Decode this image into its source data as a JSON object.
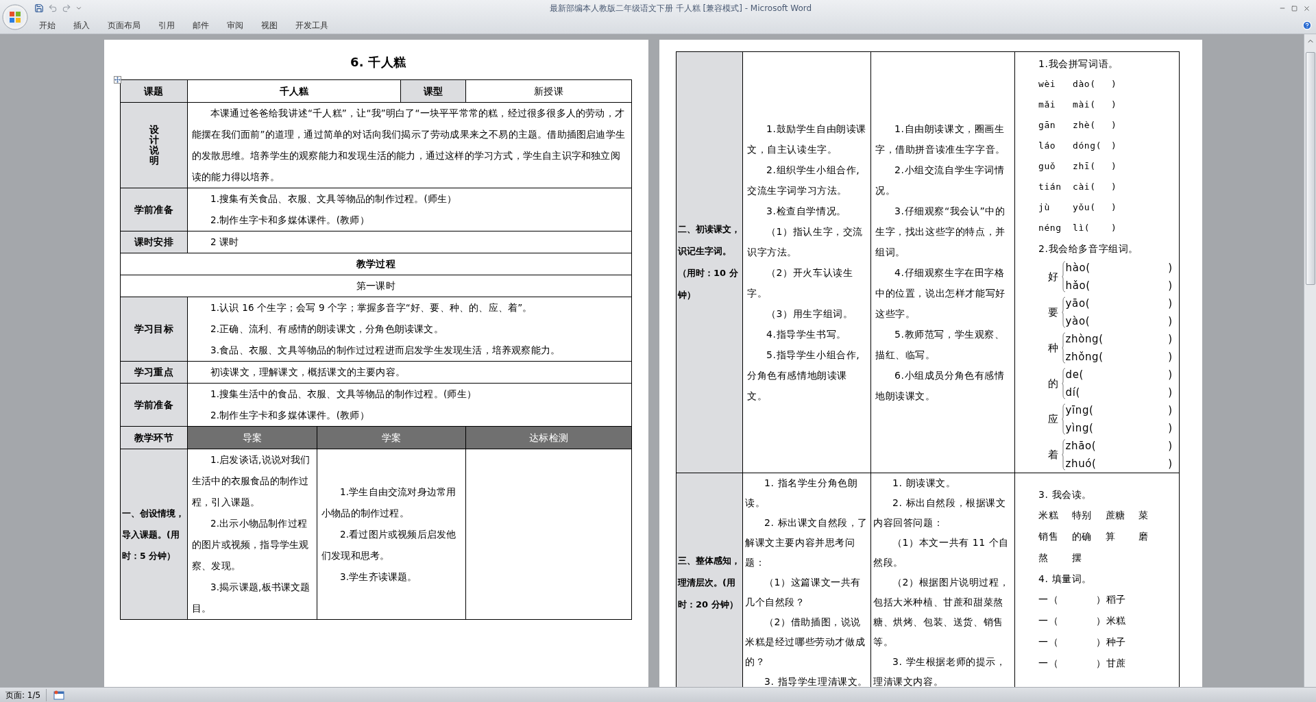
{
  "window": {
    "title": "最新部编本人教版二年级语文下册 千人糕 [兼容模式] - Microsoft Word"
  },
  "ribbon_tabs": [
    "开始",
    "插入",
    "页面布局",
    "引用",
    "邮件",
    "审阅",
    "视图",
    "开发工具"
  ],
  "left_page": {
    "title": "6. 千人糕",
    "rows": [
      {
        "kind": "title_row",
        "cells": [
          {
            "kind": "label",
            "text": "课题"
          },
          {
            "kind": "bold",
            "text": "千人糕"
          },
          {
            "kind": "label",
            "text": "课型"
          },
          {
            "kind": "plain",
            "text": "新授课"
          }
        ]
      },
      {
        "kind": "vertical_field",
        "label": "设计说明",
        "paragraphs": [
          "本课通过爸爸给我讲述“千人糕”，让“我”明白了“一块平平常常的糕，经过很多很多人的劳动，才能摆在我们面前”的道理，通过简单的对话向我们揭示了劳动成果来之不易的主题。借助插图启迪学生的发散思维。培养学生的观察能力和发现生活的能力，通过这样的学习方式，学生自主识字和独立阅读的能力得以培养。"
        ]
      },
      {
        "kind": "field",
        "label": "学前准备",
        "paragraphs": [
          "1.搜集有关食品、衣服、文具等物品的制作过程。(师生）",
          "2.制作生字卡和多媒体课件。(教师）"
        ]
      },
      {
        "kind": "field",
        "label": "课时安排",
        "paragraphs": [
          "2 课时"
        ]
      },
      {
        "kind": "heading",
        "text": "教学过程"
      },
      {
        "kind": "subheading",
        "text": "第一课时"
      },
      {
        "kind": "field",
        "label": "学习目标",
        "paragraphs": [
          "1.认识 16 个生字；会写 9 个字；掌握多音字“好、要、种、的、应、着”。",
          "2.正确、流利、有感情的朗读课文，分角色朗读课文。",
          "3.食品、衣服、文具等物品的制作过过程进而启发学生发现生活，培养观察能力。"
        ]
      },
      {
        "kind": "field",
        "label": "学习重点",
        "paragraphs": [
          "初读课文，理解课文，概括课文的主要内容。"
        ]
      },
      {
        "kind": "field",
        "label": "学前准备",
        "paragraphs": [
          "1.搜集生活中的食品、衣服、文具等物品的制作过程。(师生）",
          "2.制作生字卡和多媒体课件。(教师）"
        ]
      },
      {
        "kind": "column_header",
        "label": "教学环节",
        "columns": [
          "导案",
          "学案",
          "达标检测"
        ]
      },
      {
        "kind": "stage",
        "label": "一、创设情境，导入课题。(用时：5 分钟）",
        "cells": [
          {
            "kind": "paragraphs",
            "paragraphs": [
              "1.启发谈话,说说对我们生活中的衣服食品的制作过程，引入课题。",
              "2.出示小物品制作过程的图片或视频，指导学生观察、发现。",
              "3.揭示课题,板书课文题目。"
            ]
          },
          {
            "kind": "paragraphs",
            "paragraphs": [
              "1.学生自由交流对身边常用小物品的制作过程。",
              "2.看过图片或视频后启发他们发现和思考。",
              "3.学生齐读课题。"
            ]
          },
          {
            "kind": "empty"
          }
        ]
      }
    ]
  },
  "right_page": {
    "rows": [
      {
        "kind": "stage",
        "label": "二、初读课文，识记生字词。（用时：10 分钟）",
        "cells": [
          {
            "kind": "paragraphs",
            "paragraphs": [
              "1.鼓励学生自由朗读课文，自主认读生字。",
              "2.组织学生小组合作,交流生字词学习方法。",
              "3.检查自学情况。",
              "（1）指认生字，交流识字方法。",
              "（2）开火车认读生字。",
              "（3）用生字组词。",
              "4.指导学生书写。",
              "5.指导学生小组合作,分角色有感情地朗读课文。"
            ]
          },
          {
            "kind": "paragraphs",
            "paragraphs": [
              "1.自由朗读课文，圈画生字，借助拼音读准生字字音。",
              "2.小组交流自学生字词情况。",
              "3.仔细观察“我会认”中的生字，找出这些字的特点，并组词。",
              "4.仔细观察生字在田字格中的位置，说出怎样才能写好这些字。",
              "5.教师范写，学生观察、描红、临写。",
              "6.小组成员分角色有感情地朗读课文。"
            ]
          },
          {
            "kind": "exercises",
            "items": [
              {
                "kind": "line",
                "text": "1.我会拼写词语。"
              },
              {
                "kind": "pinyin",
                "first": "wèi",
                "second": "dào(",
                "close": ")"
              },
              {
                "kind": "pinyin",
                "first": "mǎi",
                "second": "mài(",
                "close": ")"
              },
              {
                "kind": "pinyin",
                "first": "gān",
                "second": "zhè(",
                "close": ")"
              },
              {
                "kind": "pinyin",
                "first": "láo",
                "second": "dóng(",
                "close": ")"
              },
              {
                "kind": "pinyin",
                "first": "guǒ",
                "second": "zhī(",
                "close": ")"
              },
              {
                "kind": "pinyin",
                "first": "tián",
                "second": "cài(",
                "close": ")"
              },
              {
                "kind": "pinyin",
                "first": "jù",
                "second": "yǒu(",
                "close": ")"
              },
              {
                "kind": "pinyin",
                "first": "néng",
                "second": "lì(",
                "close": ")"
              },
              {
                "kind": "line",
                "text": "2.我会给多音字组词。"
              },
              {
                "kind": "polyphone",
                "char": "好",
                "readings": [
                  {
                    "open": "hào(",
                    "close": ")"
                  },
                  {
                    "open": "hǎo(",
                    "close": ")"
                  }
                ]
              },
              {
                "kind": "polyphone",
                "char": "要",
                "readings": [
                  {
                    "open": "yāo(",
                    "close": ")"
                  },
                  {
                    "open": "yào(",
                    "close": ")"
                  }
                ]
              },
              {
                "kind": "polyphone",
                "char": "种",
                "readings": [
                  {
                    "open": "zhòng(",
                    "close": ")"
                  },
                  {
                    "open": "zhǒng(",
                    "close": ")"
                  }
                ]
              },
              {
                "kind": "polyphone",
                "char": "的",
                "readings": [
                  {
                    "open": "de(",
                    "close": ")"
                  },
                  {
                    "open": "dí(",
                    "close": ")"
                  }
                ]
              },
              {
                "kind": "polyphone",
                "char": "应",
                "readings": [
                  {
                    "open": "yīng(",
                    "close": ")"
                  },
                  {
                    "open": "yìng(",
                    "close": ")"
                  }
                ]
              },
              {
                "kind": "polyphone",
                "char": "着",
                "readings": [
                  {
                    "open": "zhāo(",
                    "close": ")"
                  },
                  {
                    "open": "zhuó(",
                    "close": ")"
                  }
                ]
              }
            ]
          }
        ]
      },
      {
        "kind": "stage",
        "label": "三、整体感知，理清层次。(用时：20 分钟）",
        "cells": [
          {
            "kind": "paragraphs",
            "paragraphs": [
              "1. 指名学生分角色朗读。",
              "2. 标出课文自然段，了解课文主要内容并思考问题：",
              "（1）这篇课文一共有几个自然段？",
              "（2）借助插图，说说米糕是经过哪些劳动才做成的？",
              "3. 指导学生理清课文。"
            ]
          },
          {
            "kind": "paragraphs",
            "paragraphs": [
              "1. 朗读课文。",
              "2. 标出自然段，根据课文内容回答问题：",
              "（1）本文一共有 11 个自然段。",
              "（2）根据图片说明过程，包括大米种植、甘蔗和甜菜熬糖、烘烤、包装、送货、销售等。",
              "3. 学生根据老师的提示，理清课文内容。"
            ]
          },
          {
            "kind": "exercises",
            "items": [
              {
                "kind": "line",
                "text": "3. 我会读。"
              },
              {
                "kind": "word_row",
                "words": [
                  "米糕",
                  "特别",
                  "蔗糖",
                  "菜"
                ]
              },
              {
                "kind": "word_row",
                "words": [
                  "销售",
                  "的确",
                  "算",
                  "磨"
                ]
              },
              {
                "kind": "word_row",
                "words": [
                  "熬",
                  "摆"
                ]
              },
              {
                "kind": "line",
                "text": "4. 填量词。"
              },
              {
                "kind": "fill",
                "prefix": "一（",
                "suffix": "）稻子"
              },
              {
                "kind": "fill",
                "prefix": "一（",
                "suffix": "）米糕"
              },
              {
                "kind": "fill",
                "prefix": "一（",
                "suffix": "）种子"
              },
              {
                "kind": "fill",
                "prefix": "一（",
                "suffix": "）甘蔗"
              }
            ]
          }
        ]
      }
    ]
  },
  "status_bar": {
    "page": "页面: 1/5"
  }
}
